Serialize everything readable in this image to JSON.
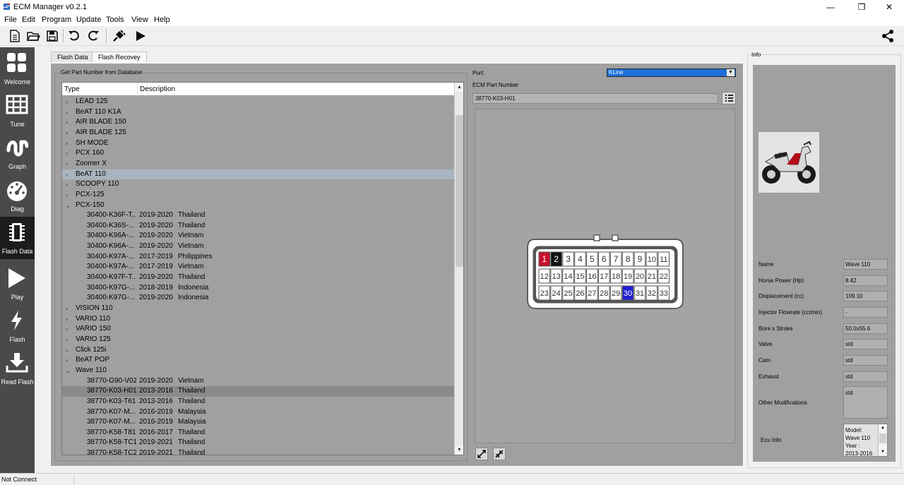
{
  "window": {
    "title": "ECM Manager v0.2.1",
    "controls": [
      "—",
      "❐",
      "✕"
    ]
  },
  "menu": [
    "File",
    "Edit",
    "Program",
    "Update",
    "Tools",
    "View",
    "Help"
  ],
  "toolbar": {
    "icons": [
      "new-file-icon",
      "open-folder-icon",
      "save-icon",
      "undo-icon",
      "redo-icon",
      "plug-icon",
      "play-icon"
    ],
    "right_icon": "share-icon"
  },
  "sidebar": [
    {
      "label": "Welcome",
      "icon": "grid-icon"
    },
    {
      "label": "Tune",
      "icon": "table-icon"
    },
    {
      "label": "Graph",
      "icon": "graph-icon"
    },
    {
      "label": "Diag",
      "icon": "gauge-icon"
    },
    {
      "label": "Flash Data",
      "icon": "chip-icon",
      "active": true
    },
    {
      "label": "Play",
      "icon": "play-icon"
    },
    {
      "label": "Flash",
      "icon": "lightning-icon"
    },
    {
      "label": "Read Flash",
      "icon": "download-icon"
    }
  ],
  "tabs": [
    {
      "label": "Flash Data"
    },
    {
      "label": "Flash Recovey",
      "active": true
    }
  ],
  "database": {
    "group_title": "Get Part Number from Database",
    "columns": [
      "Type",
      "Description"
    ],
    "rows": [
      {
        "kind": "group",
        "expanded": false,
        "type": "LEAD 125"
      },
      {
        "kind": "group",
        "expanded": false,
        "type": "BeAT 110 K1A"
      },
      {
        "kind": "group",
        "expanded": false,
        "type": "AIR BLADE 150"
      },
      {
        "kind": "group",
        "expanded": false,
        "type": "AIR BLADE 125"
      },
      {
        "kind": "group",
        "expanded": false,
        "type": "SH MODE"
      },
      {
        "kind": "group",
        "expanded": false,
        "type": "PCX 160"
      },
      {
        "kind": "group",
        "expanded": false,
        "type": "Zoomer X"
      },
      {
        "kind": "group",
        "expanded": false,
        "type": "BeAT 110",
        "highlight": "light"
      },
      {
        "kind": "group",
        "expanded": false,
        "type": "SCOOPY 110"
      },
      {
        "kind": "group",
        "expanded": false,
        "type": "PCX-125"
      },
      {
        "kind": "group",
        "expanded": true,
        "type": "PCX-150"
      },
      {
        "kind": "child",
        "type": "30400-K36F-T...",
        "year": "2019-2020",
        "country": "Thailand"
      },
      {
        "kind": "child",
        "type": "30400-K36S-...",
        "year": "2019-2020",
        "country": "Thailand"
      },
      {
        "kind": "child",
        "type": "30400-K96A-...",
        "year": "2019-2020",
        "country": "Vietnam"
      },
      {
        "kind": "child",
        "type": "30400-K96A-...",
        "year": "2019-2020",
        "country": "Vietnam"
      },
      {
        "kind": "child",
        "type": "30400-K97A-...",
        "year": "2017-2019",
        "country": "Philippines"
      },
      {
        "kind": "child",
        "type": "30400-K97A-...",
        "year": "2017-2019",
        "country": "Vietnam"
      },
      {
        "kind": "child",
        "type": "30400-K97F-T...",
        "year": "2019-2020",
        "country": "Thailand"
      },
      {
        "kind": "child",
        "type": "30400-K97G-...",
        "year": "2018-2019",
        "country": "Indonesia"
      },
      {
        "kind": "child",
        "type": "30400-K97G-...",
        "year": "2019-2020",
        "country": "Indonesia"
      },
      {
        "kind": "group",
        "expanded": false,
        "type": "VISION 110"
      },
      {
        "kind": "group",
        "expanded": false,
        "type": "VARIO 110"
      },
      {
        "kind": "group",
        "expanded": false,
        "type": "VARIO 150"
      },
      {
        "kind": "group",
        "expanded": false,
        "type": "VARIO 125"
      },
      {
        "kind": "group",
        "expanded": false,
        "type": "Click 125i"
      },
      {
        "kind": "group",
        "expanded": false,
        "type": "BeAT POP"
      },
      {
        "kind": "group",
        "expanded": true,
        "type": "Wave 110"
      },
      {
        "kind": "child",
        "type": "38770-G90-V02",
        "year": "2019-2020",
        "country": "Vietnam"
      },
      {
        "kind": "child",
        "type": "38770-K03-H01",
        "year": "2013-2016",
        "country": "Thailand",
        "highlight": "dark"
      },
      {
        "kind": "child",
        "type": "38770-K03-T61",
        "year": "2013-2016",
        "country": "Thailand"
      },
      {
        "kind": "child",
        "type": "38770-K07-M...",
        "year": "2016-2019",
        "country": "Malaysia"
      },
      {
        "kind": "child",
        "type": "38770-K07-M...",
        "year": "2016-2019",
        "country": "Malaysia"
      },
      {
        "kind": "child",
        "type": "38770-K58-T81",
        "year": "2016-2017",
        "country": "Thailand"
      },
      {
        "kind": "child",
        "type": "38770-K58-TC1",
        "year": "2019-2021",
        "country": "Thailand"
      },
      {
        "kind": "child",
        "type": "38770-K58-TC2",
        "year": "2019-2021",
        "country": "Thailand"
      }
    ]
  },
  "port": {
    "label": "Port:",
    "value": "KLine"
  },
  "ecm_part": {
    "label": "ECM Part Number",
    "value": "38770-K03-H01"
  },
  "connector": {
    "pins": [
      [
        "1",
        "2",
        "3",
        "4",
        "5",
        "6",
        "7",
        "8",
        "9",
        "10",
        "11"
      ],
      [
        "12",
        "13",
        "14",
        "15",
        "16",
        "17",
        "18",
        "19",
        "20",
        "21",
        "22"
      ],
      [
        "23",
        "24",
        "25",
        "26",
        "27",
        "28",
        "29",
        "30",
        "31",
        "32",
        "33"
      ]
    ],
    "pin_colors": {
      "1": "#c8102e",
      "2": "#111111",
      "30": "#1f1fd6"
    },
    "default_pin_color": "#ffffff"
  },
  "info": {
    "title": "Info",
    "fields": [
      {
        "label": "Name",
        "value": "Wave 110"
      },
      {
        "label": "Horse Power (Hp)",
        "value": "8.42"
      },
      {
        "label": "Displacement (cc)",
        "value": "109.10"
      },
      {
        "label": "Injector Flowrate (cc/min)",
        "value": "-"
      },
      {
        "label": "Bore x Stroke",
        "value": "50.0x55.6"
      },
      {
        "label": "Valve",
        "value": "std"
      },
      {
        "label": "Cam",
        "value": "std"
      },
      {
        "label": "Exhaust",
        "value": "std"
      }
    ],
    "other_mod_label": "Other Modifications",
    "other_mod_value": "std",
    "ecu_info_label": "Ecu Info",
    "ecu_info_lines": [
      "Model:",
      "Wave 110",
      "Year :",
      "2013-2016"
    ]
  },
  "status": {
    "text": "Not Connect"
  }
}
